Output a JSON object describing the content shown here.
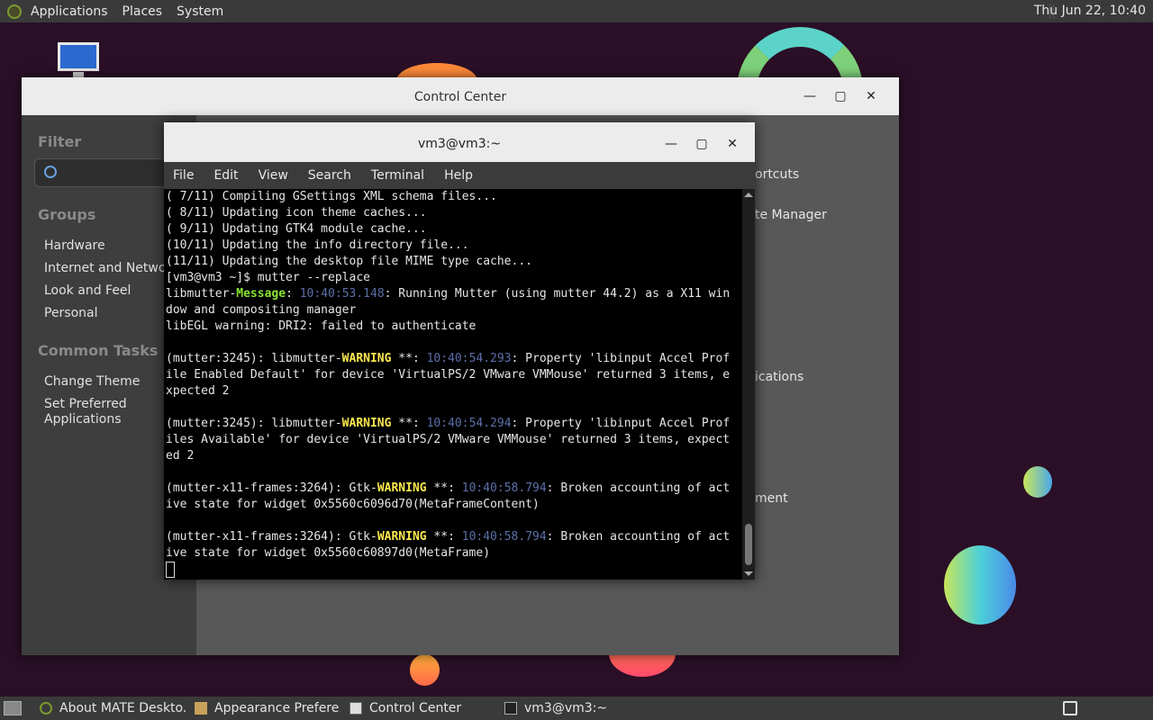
{
  "top_panel": {
    "menus": [
      "Applications",
      "Places",
      "System"
    ],
    "clock": "Thu Jun 22, 10:40"
  },
  "control_center": {
    "title": "Control Center",
    "filter_heading": "Filter",
    "groups_heading": "Groups",
    "groups": [
      "Hardware",
      "Internet and Network",
      "Look and Feel",
      "Personal"
    ],
    "common_tasks_heading": "Common Tasks",
    "tasks": [
      "Change Theme",
      "Set Preferred",
      "Applications"
    ],
    "peek_labels": [
      "ortcuts",
      "te Manager",
      "ications",
      "ment"
    ]
  },
  "terminal": {
    "title": "vm3@vm3:~",
    "menu": [
      "File",
      "Edit",
      "View",
      "Search",
      "Terminal",
      "Help"
    ],
    "lines": [
      [
        {
          "t": "( 7/11) Compiling GSettings XML schema files..."
        }
      ],
      [
        {
          "t": "( 8/11) Updating icon theme caches..."
        }
      ],
      [
        {
          "t": "( 9/11) Updating GTK4 module cache..."
        }
      ],
      [
        {
          "t": "(10/11) Updating the info directory file..."
        }
      ],
      [
        {
          "t": "(11/11) Updating the desktop file MIME type cache..."
        }
      ],
      [
        {
          "t": "[vm3@vm3 ~]$ mutter --replace"
        }
      ],
      [
        {
          "t": "libmutter-"
        },
        {
          "t": "Message",
          "c": "g"
        },
        {
          "t": ": "
        },
        {
          "t": "10:40:53.148",
          "c": "b"
        },
        {
          "t": ": Running Mutter (using mutter 44.2) as a X11 win"
        }
      ],
      [
        {
          "t": "dow and compositing manager"
        }
      ],
      [
        {
          "t": "libEGL warning: DRI2: failed to authenticate"
        }
      ],
      [
        {
          "t": ""
        }
      ],
      [
        {
          "t": "(mutter:3245): libmutter-"
        },
        {
          "t": "WARNING",
          "c": "y"
        },
        {
          "t": " **: "
        },
        {
          "t": "10:40:54.293",
          "c": "b"
        },
        {
          "t": ": Property 'libinput Accel Prof"
        }
      ],
      [
        {
          "t": "ile Enabled Default' for device 'VirtualPS/2 VMware VMMouse' returned 3 items, e"
        }
      ],
      [
        {
          "t": "xpected 2"
        }
      ],
      [
        {
          "t": ""
        }
      ],
      [
        {
          "t": "(mutter:3245): libmutter-"
        },
        {
          "t": "WARNING",
          "c": "y"
        },
        {
          "t": " **: "
        },
        {
          "t": "10:40:54.294",
          "c": "b"
        },
        {
          "t": ": Property 'libinput Accel Prof"
        }
      ],
      [
        {
          "t": "iles Available' for device 'VirtualPS/2 VMware VMMouse' returned 3 items, expect"
        }
      ],
      [
        {
          "t": "ed 2"
        }
      ],
      [
        {
          "t": ""
        }
      ],
      [
        {
          "t": "(mutter-x11-frames:3264): Gtk-"
        },
        {
          "t": "WARNING",
          "c": "y"
        },
        {
          "t": " **: "
        },
        {
          "t": "10:40:58.794",
          "c": "b"
        },
        {
          "t": ": Broken accounting of act"
        }
      ],
      [
        {
          "t": "ive state for widget 0x5560c6096d70(MetaFrameContent)"
        }
      ],
      [
        {
          "t": ""
        }
      ],
      [
        {
          "t": "(mutter-x11-frames:3264): Gtk-"
        },
        {
          "t": "WARNING",
          "c": "y"
        },
        {
          "t": " **: "
        },
        {
          "t": "10:40:58.794",
          "c": "b"
        },
        {
          "t": ": Broken accounting of act"
        }
      ],
      [
        {
          "t": "ive state for widget 0x5560c60897d0(MetaFrame)"
        }
      ]
    ]
  },
  "taskbar": {
    "tasks": [
      {
        "label": "About MATE Deskto...",
        "icon": "mate-logo-icon"
      },
      {
        "label": "Appearance Prefere...",
        "icon": "appearance-icon"
      },
      {
        "label": "Control Center",
        "icon": "control-center-icon"
      },
      {
        "label": "vm3@vm3:~",
        "icon": "terminal-icon"
      }
    ]
  }
}
